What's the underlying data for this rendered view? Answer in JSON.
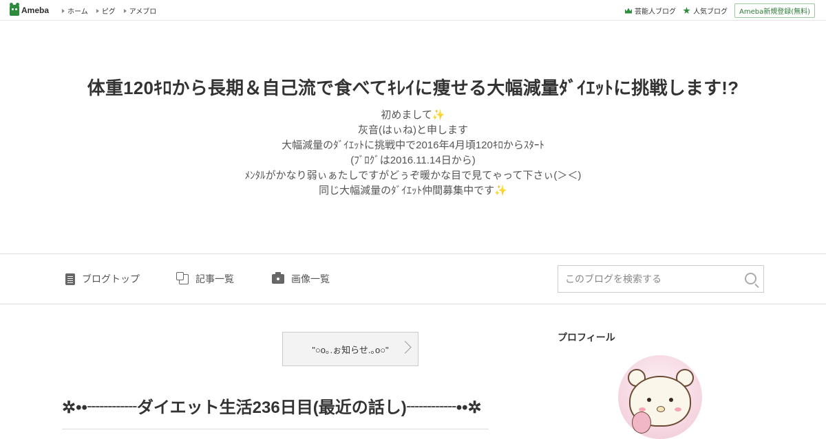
{
  "topbar": {
    "logo_text": "Ameba",
    "nav": [
      "ホーム",
      "ピグ",
      "アメブロ"
    ],
    "celebrity_blog": "芸能人ブログ",
    "popular_blog": "人気ブログ",
    "register": "Ameba新規登録(無料)"
  },
  "header": {
    "title": "体重120ｷﾛから長期＆自己流で食べてｷﾚｲに痩せる大幅減量ﾀﾞｲｴｯﾄに挑戦します!?",
    "description": [
      "初めまして✨",
      "灰音(はぃね)と申します",
      "大幅減量のﾀﾞｲｴｯﾄに挑戦中で2016年4月頃120ｷﾛからｽﾀｰﾄ",
      "(ﾌﾞﾛｸﾞは2016.11.14日から)",
      "ﾒﾝﾀﾙがかなり弱ぃぁたしですがどぅぞ暖かな目で見てゃって下さぃ(＞＜)",
      "同じ大幅減量のﾀﾞｲｴｯﾄ仲間募集中です✨"
    ]
  },
  "nav": {
    "blog_top": "ブログトップ",
    "articles": "記事一覧",
    "images": "画像一覧",
    "search_placeholder": "このブログを検索する"
  },
  "main": {
    "notice_button": "\"○o｡.ぉ知らせ.｡o○\"",
    "article_title": "✲••┈┈┈ダイエット生活236日目(最近の話し)┈┈┈••✲"
  },
  "sidebar": {
    "profile_title": "プロフィール"
  },
  "colors": {
    "accent_green": "#2d8c3c",
    "text": "#333333",
    "border": "#dddddd"
  }
}
